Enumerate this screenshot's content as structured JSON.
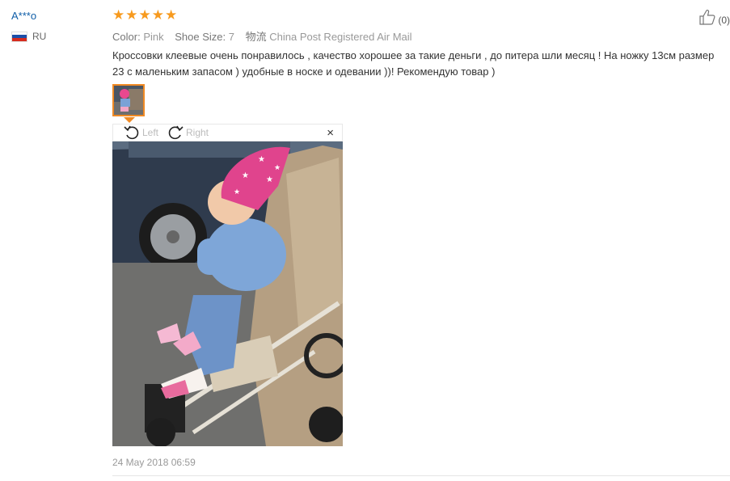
{
  "buyer": {
    "name": "A***o",
    "country_code": "RU"
  },
  "rating": {
    "stars": 5
  },
  "helpful": {
    "count_label": "(0)",
    "icon": "thumbs-up-icon"
  },
  "meta": {
    "color_key": "Color:",
    "color_val": "Pink",
    "size_key": "Shoe Size:",
    "size_val": "7",
    "logistics_key": "物流",
    "logistics_val": "China Post Registered Air Mail"
  },
  "review": {
    "text": "Кроссовки клеевые очень понравилось , качество хорошее за такие деньги , до питера шли месяц ! На ножку 13см размер 23 с маленьким запасом ) удобные в носке и одевании ))! Рекомендую товар )"
  },
  "viewer": {
    "rotate_left": "Left",
    "rotate_right": "Right",
    "close": "×"
  },
  "footer": {
    "date": "24 May 2018 06:59"
  },
  "colors": {
    "accent": "#f08a24",
    "star": "#f79a1e",
    "link": "#0f5ea8"
  }
}
